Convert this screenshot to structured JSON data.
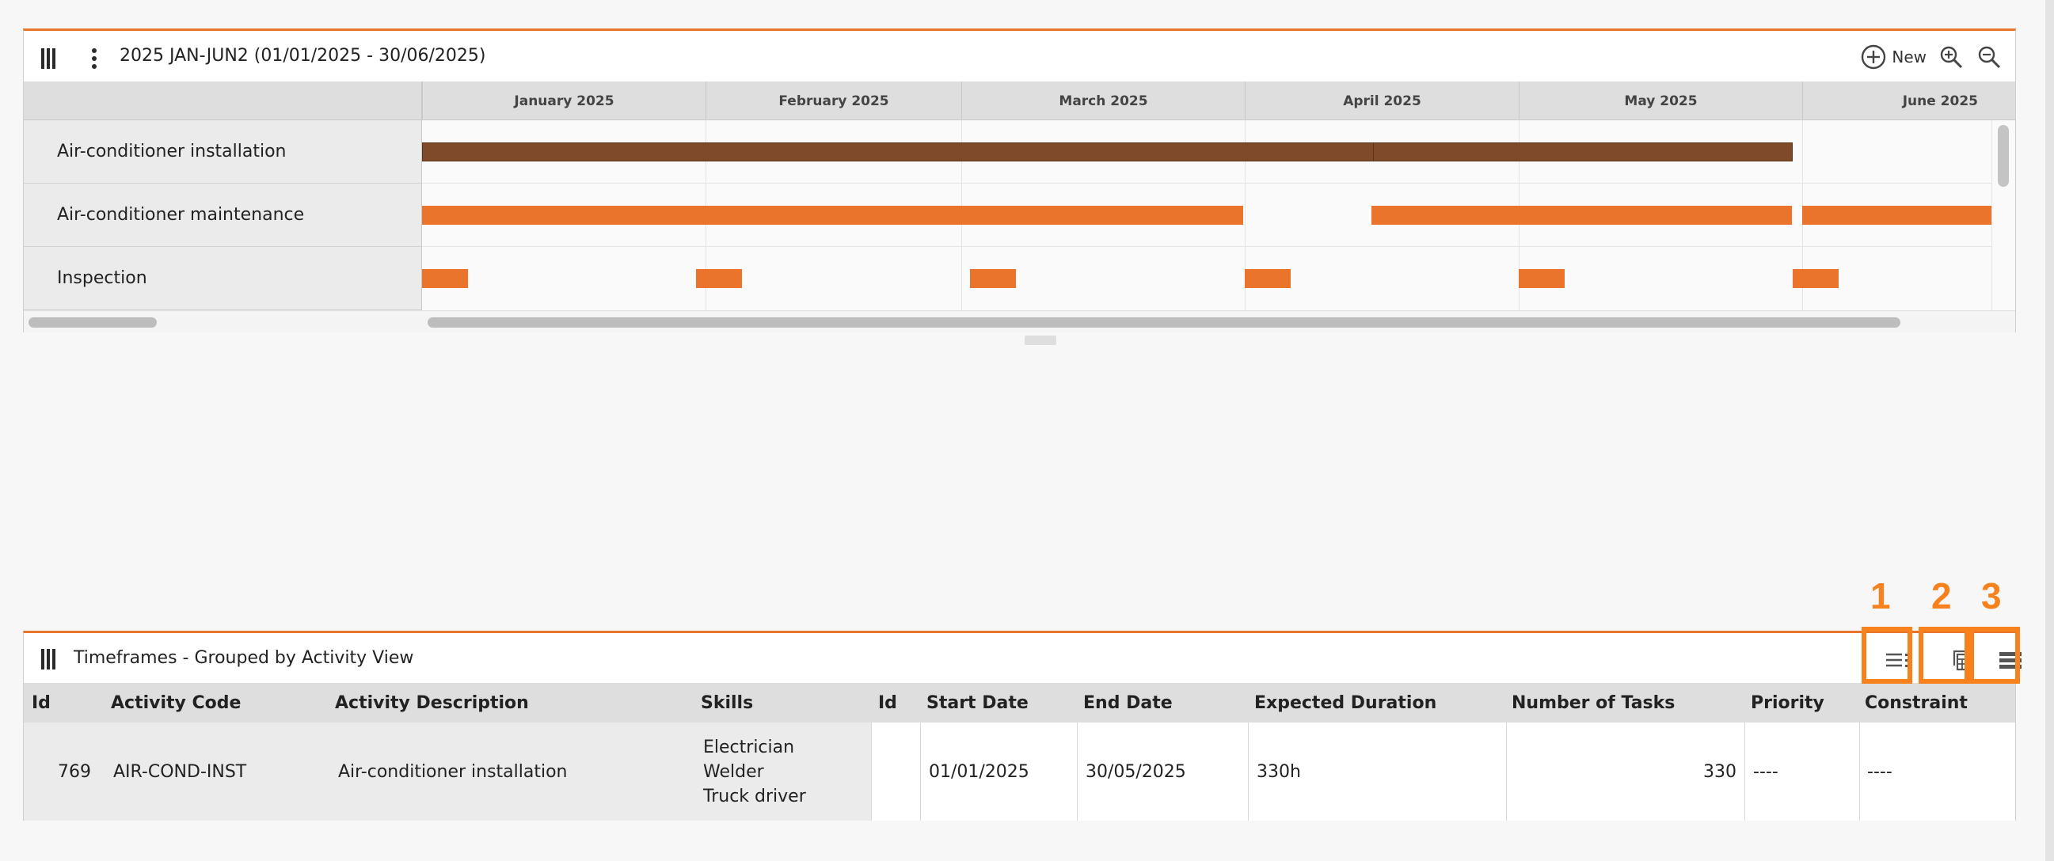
{
  "gantt": {
    "title": "2025 JAN-JUN2 (01/01/2025 - 30/06/2025)",
    "new_label": "New",
    "icons": {
      "columns": "columns-icon",
      "menu": "kebab-menu-icon",
      "add": "plus-circle-icon",
      "zoom_in": "zoom-in-icon",
      "zoom_out": "zoom-out-icon"
    },
    "months": [
      "January 2025",
      "February 2025",
      "March 2025",
      "April 2025",
      "May 2025",
      "June 2025"
    ],
    "rows": [
      {
        "label": "Air-conditioner installation"
      },
      {
        "label": "Air-conditioner maintenance"
      },
      {
        "label": "Inspection"
      }
    ],
    "colors": {
      "accent": "#e9742b",
      "bar": "#ea742c",
      "bar_selected": "#7e4a2a",
      "callout": "#f7811d"
    }
  },
  "callouts": [
    "1",
    "2",
    "3"
  ],
  "grid": {
    "title": "Timeframes - Grouped by Activity View",
    "view_icons": [
      "list-view-icon",
      "calendar-view-icon",
      "compact-view-icon"
    ],
    "columns": [
      "Id",
      "Activity Code",
      "Activity Description",
      "Skills",
      "Id",
      "Start Date",
      "End Date",
      "Expected Duration",
      "Number of Tasks",
      "Priority",
      "Constraint"
    ],
    "rows": [
      {
        "id": "769",
        "activity_code": "AIR-COND-INST",
        "activity_description": "Air-conditioner installation",
        "skills": [
          "Electrician",
          "Welder",
          "Truck driver"
        ],
        "timeframe_id": "",
        "start_date": "01/01/2025",
        "end_date": "30/05/2025",
        "expected_duration": "330h",
        "number_of_tasks": "330",
        "priority": "----",
        "constraint": "----"
      }
    ]
  }
}
